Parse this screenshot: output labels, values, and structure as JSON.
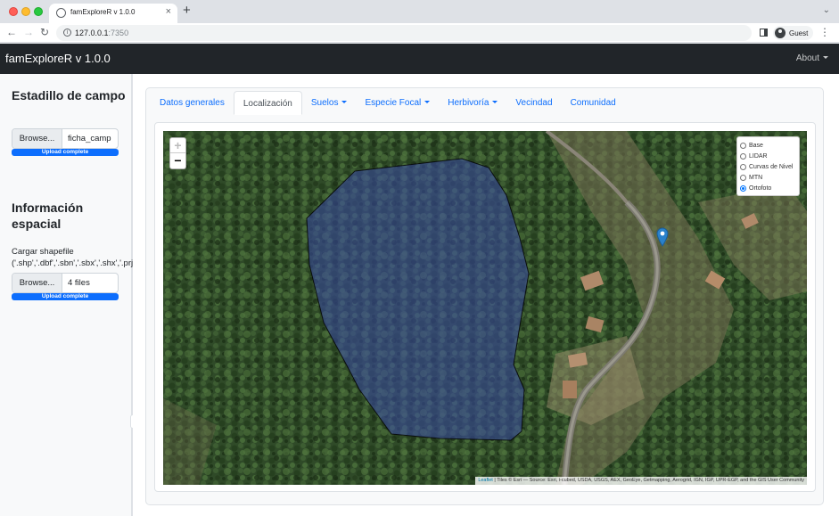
{
  "browser": {
    "tab_title": "famExploreR v 1.0.0",
    "url_host": "127.0.0.1",
    "url_port": ":7350",
    "profile": "Guest"
  },
  "navbar": {
    "brand": "famExploreR v 1.0.0",
    "about": "About"
  },
  "sidebar": {
    "section1_title": "Estadillo de campo",
    "file1": {
      "button": "Browse...",
      "filename": "ficha_camp",
      "progress_label": "Upload complete",
      "progress": 1.0
    },
    "section2_title": "Información espacial",
    "shapefile_label_line1": "Cargar shapefile",
    "shapefile_label_line2": "('.shp','.dbf','.sbn','.sbx','.shx','.prj",
    "file2": {
      "button": "Browse...",
      "filename": "4 files",
      "progress_label": "Upload complete",
      "progress": 1.0
    }
  },
  "tabs": [
    {
      "label": "Datos generales",
      "active": false,
      "dropdown": false
    },
    {
      "label": "Localización",
      "active": true,
      "dropdown": false
    },
    {
      "label": "Suelos",
      "active": false,
      "dropdown": true
    },
    {
      "label": "Especie Focal",
      "active": false,
      "dropdown": true
    },
    {
      "label": "Herbivoría",
      "active": false,
      "dropdown": true
    },
    {
      "label": "Vecindad",
      "active": false,
      "dropdown": false
    },
    {
      "label": "Comunidad",
      "active": false,
      "dropdown": false
    }
  ],
  "map": {
    "zoom_in": "+",
    "zoom_out": "−",
    "layers": [
      {
        "label": "Base",
        "selected": false
      },
      {
        "label": "LIDAR",
        "selected": false
      },
      {
        "label": "Curvas de Nivel",
        "selected": false
      },
      {
        "label": "MTN",
        "selected": false
      },
      {
        "label": "Ortofoto",
        "selected": true
      }
    ],
    "attribution_link": "Leaflet",
    "attribution_text": " | Tiles © Esri — Source: Esri, i-cubed, USDA, USGS, AEX, GeoEye, Getmapping, Aerogrid, IGN, IGP, UPR-EGP, and the GIS User Community",
    "polygon_color": "#3a4aa8",
    "marker_color": "#2a81cb"
  }
}
